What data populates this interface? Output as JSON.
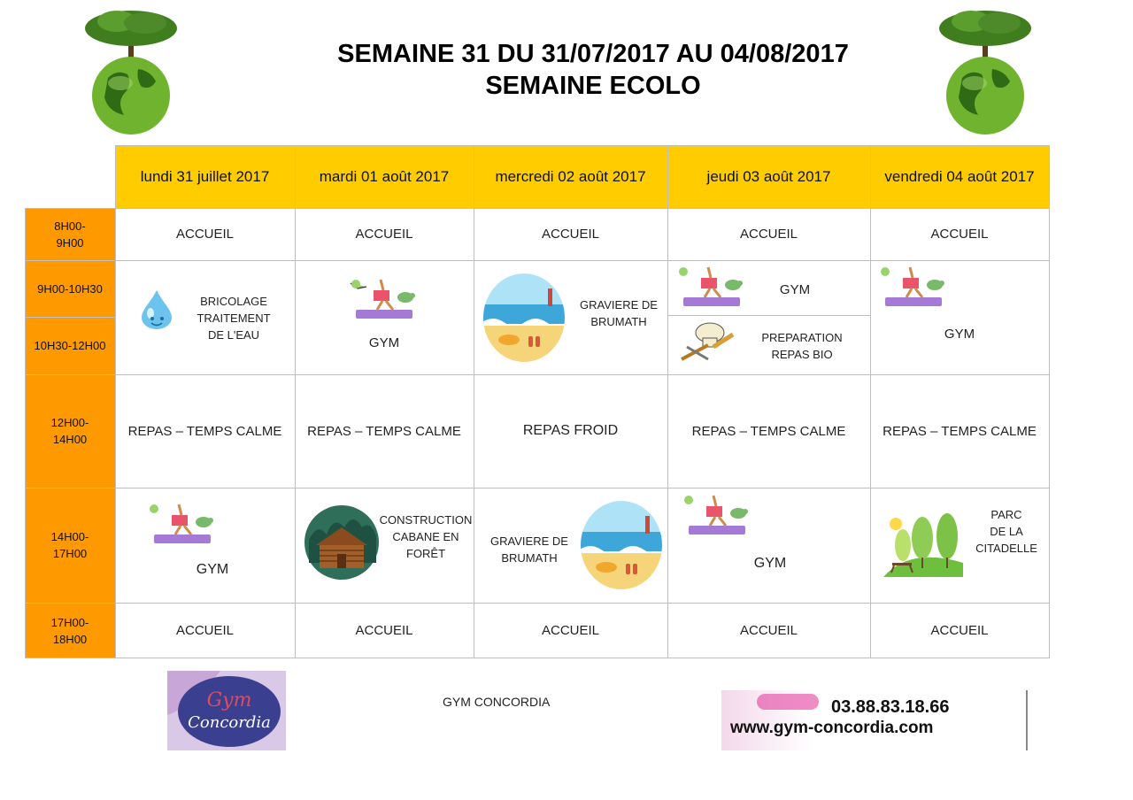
{
  "header": {
    "title_line1": "SEMAINE 31 DU 31/07/2017 AU 04/08/2017",
    "title_line2": "SEMAINE ECOLO"
  },
  "days": [
    "lundi 31 juillet 2017",
    "mardi 01 août 2017",
    "mercredi 02 août 2017",
    "jeudi 03 août 2017",
    "vendredi 04 août 2017"
  ],
  "times": {
    "t1": [
      "8H00-",
      "9H00"
    ],
    "t2": "9H00-10H30",
    "t3": "10H30-12H00",
    "t4": [
      "12H00-",
      "14H00"
    ],
    "t5": [
      "14H00-",
      "17H00"
    ],
    "t6": [
      "17H00-",
      "18H00"
    ]
  },
  "accueil": "ACCUEIL",
  "morning": {
    "mon": [
      "BRICOLAGE",
      "TRAITEMENT",
      "DE L'EAU"
    ],
    "tue": "GYM",
    "wed": [
      "GRAVIERE DE",
      "BRUMATH"
    ],
    "thu_top": "GYM",
    "thu_bottom": [
      "PREPARATION",
      "REPAS BIO"
    ],
    "fri": "GYM"
  },
  "lunch": {
    "mon": "REPAS – TEMPS CALME",
    "tue": "REPAS – TEMPS CALME",
    "wed": "REPAS FROID",
    "thu": "REPAS – TEMPS CALME",
    "fri": "REPAS – TEMPS CALME"
  },
  "afternoon": {
    "mon": "GYM",
    "tue": [
      "CONSTRUCTION",
      "CABANE EN",
      "FORÊT"
    ],
    "wed": [
      "GRAVIERE DE",
      "BRUMATH"
    ],
    "thu": "GYM",
    "fri": [
      "PARC",
      "DE LA",
      "CITADELLE"
    ]
  },
  "footer": {
    "club": "GYM CONCORDIA",
    "phone": "03.88.83.18.66",
    "website": "www.gym-concordia.com",
    "logo_text": "Gym Concordia"
  },
  "colors": {
    "header_yellow": "#ffcc00",
    "time_orange": "#ff9900",
    "grid": "#bfbfbf",
    "tree_green": "#4f8a2a"
  },
  "icons": [
    "earth-tree-icon",
    "water-drop-icon",
    "gym-kids-icon",
    "beach-icon",
    "cooking-icon",
    "cabin-icon",
    "park-icon"
  ]
}
